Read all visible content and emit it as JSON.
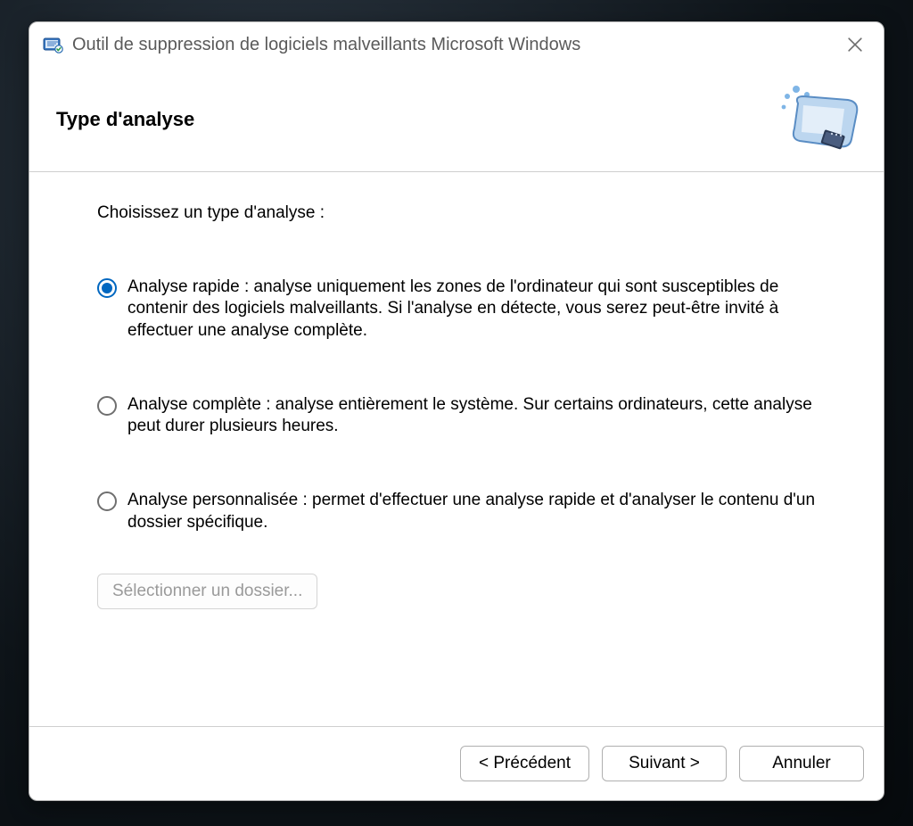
{
  "titlebar": {
    "title": "Outil de suppression de logiciels malveillants Microsoft Windows"
  },
  "header": {
    "heading": "Type d'analyse"
  },
  "content": {
    "prompt": "Choisissez un type d'analyse :",
    "options": [
      {
        "id": "quick",
        "label": "Analyse rapide : analyse uniquement les zones de l'ordinateur qui sont susceptibles de contenir des logiciels malveillants. Si l'analyse en détecte, vous serez peut-être invité à effectuer une analyse complète.",
        "checked": true
      },
      {
        "id": "full",
        "label": "Analyse complète : analyse entièrement le système. Sur certains ordinateurs, cette analyse peut durer plusieurs heures.",
        "checked": false
      },
      {
        "id": "custom",
        "label": "Analyse personnalisée : permet d'effectuer une analyse rapide et d'analyser le contenu d'un dossier spécifique.",
        "checked": false
      }
    ],
    "select_folder_label": "Sélectionner un dossier...",
    "select_folder_enabled": false
  },
  "footer": {
    "back_label": "< Précédent",
    "next_label": "Suivant >",
    "cancel_label": "Annuler"
  }
}
